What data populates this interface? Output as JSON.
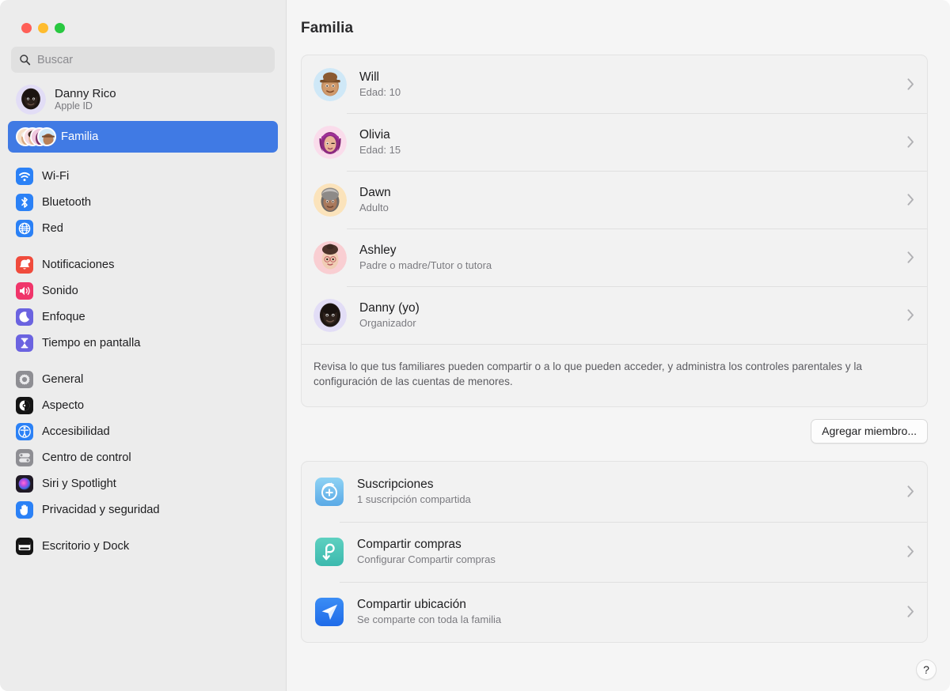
{
  "window": {
    "traffic_lights": [
      "close",
      "minimize",
      "zoom"
    ],
    "colors": {
      "close": "#ff5f57",
      "minimize": "#febc2e",
      "zoom": "#28c840",
      "accent": "#407ae4"
    }
  },
  "sidebar": {
    "search": {
      "placeholder": "Buscar",
      "value": "",
      "icon": "search-icon"
    },
    "account": {
      "name": "Danny Rico",
      "subtitle": "Apple ID",
      "icon": "memoji-avatar"
    },
    "items": [
      {
        "label": "Familia",
        "icon": "family-avatars-icon",
        "selected": true
      },
      {
        "label": "Wi-Fi",
        "icon": "wifi-icon",
        "selected": false
      },
      {
        "label": "Bluetooth",
        "icon": "bluetooth-icon",
        "selected": false
      },
      {
        "label": "Red",
        "icon": "network-globe-icon",
        "selected": false
      },
      {
        "label": "Notificaciones",
        "icon": "bell-icon",
        "selected": false
      },
      {
        "label": "Sonido",
        "icon": "speaker-icon",
        "selected": false
      },
      {
        "label": "Enfoque",
        "icon": "moon-icon",
        "selected": false
      },
      {
        "label": "Tiempo en pantalla",
        "icon": "hourglass-icon",
        "selected": false
      },
      {
        "label": "General",
        "icon": "gear-icon",
        "selected": false
      },
      {
        "label": "Aspecto",
        "icon": "appearance-icon",
        "selected": false
      },
      {
        "label": "Accesibilidad",
        "icon": "accessibility-icon",
        "selected": false
      },
      {
        "label": "Centro de control",
        "icon": "control-center-icon",
        "selected": false
      },
      {
        "label": "Siri y Spotlight",
        "icon": "siri-icon",
        "selected": false
      },
      {
        "label": "Privacidad y seguridad",
        "icon": "hand-privacy-icon",
        "selected": false
      },
      {
        "label": "Escritorio y Dock",
        "icon": "desktop-dock-icon",
        "selected": false
      }
    ]
  },
  "main": {
    "title": "Familia",
    "members": [
      {
        "name": "Will",
        "role": "Edad: 10",
        "avatar_bg": "#cfe8f7"
      },
      {
        "name": "Olivia",
        "role": "Edad: 15",
        "avatar_bg": "#fadceb"
      },
      {
        "name": "Dawn",
        "role": "Adulto",
        "avatar_bg": "#fbe3bb"
      },
      {
        "name": "Ashley",
        "role": "Padre o madre/Tutor o tutora",
        "avatar_bg": "#f9ced2"
      },
      {
        "name": "Danny (yo)",
        "role": "Organizador",
        "avatar_bg": "#e2ddf6"
      }
    ],
    "footnote": "Revisa lo que tus familiares pueden compartir o a lo que pueden acceder, y administra los controles parentales y la configuración de las cuentas de menores.",
    "add_member_label": "Agregar miembro...",
    "services": [
      {
        "title": "Suscripciones",
        "subtitle": "1 suscripción compartida",
        "icon": "subscriptions-icon"
      },
      {
        "title": "Compartir compras",
        "subtitle": "Configurar Compartir compras",
        "icon": "purchase-sharing-icon"
      },
      {
        "title": "Compartir ubicación",
        "subtitle": "Se comparte con toda la familia",
        "icon": "location-sharing-icon"
      }
    ],
    "help_label": "?"
  }
}
